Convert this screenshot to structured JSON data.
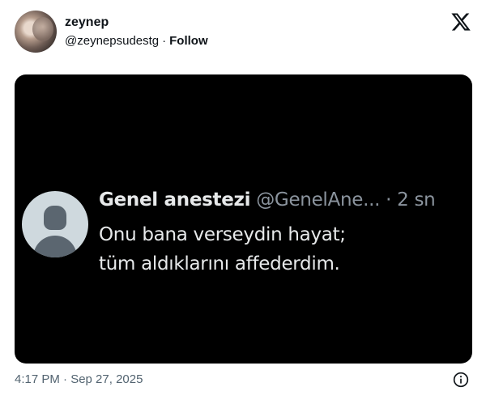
{
  "tweet": {
    "display_name": "zeynep",
    "handle": "@zeynepsudestg",
    "separator": "·",
    "follow_label": "Follow",
    "timestamp": "4:17 PM · Sep 27, 2025"
  },
  "embedded": {
    "name": "Genel anestezi",
    "handle_time": "@GenelAne... · 2 sn",
    "text_line1": "Onu bana verseydin hayat;",
    "text_line2": "tüm aldıklarını affederdim."
  },
  "icons": {
    "logo": "x-logo-icon",
    "info": "info-icon"
  },
  "colors": {
    "media_background": "#000000",
    "secondary_text": "#536471"
  }
}
